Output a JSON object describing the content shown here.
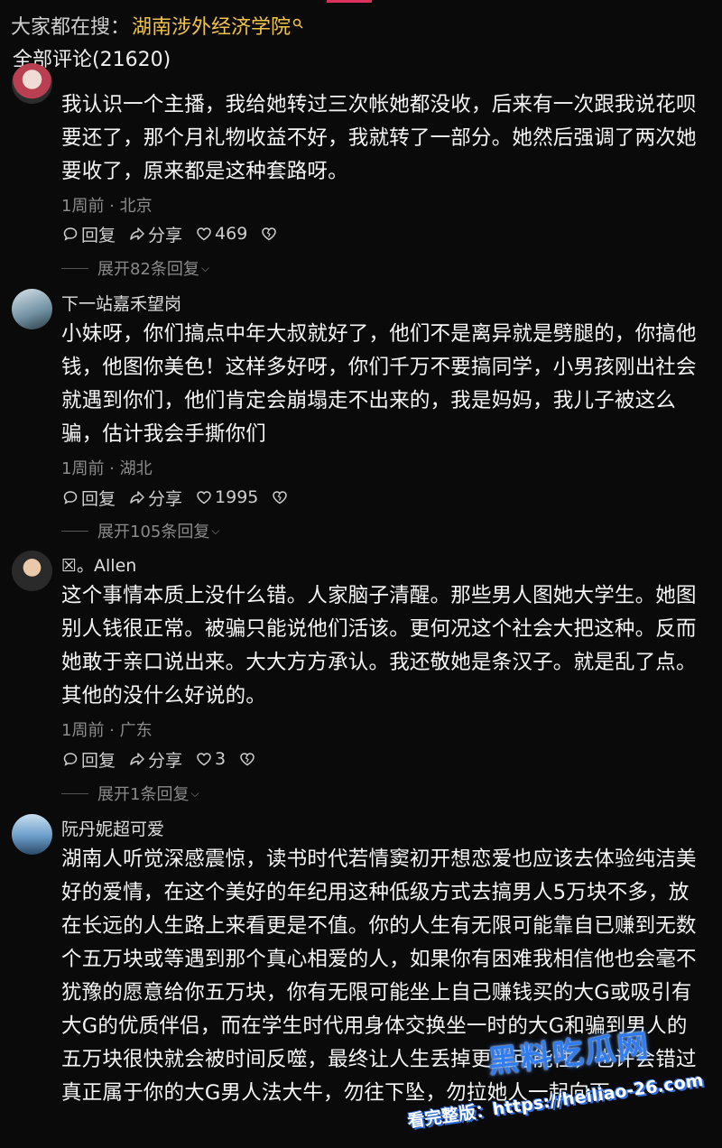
{
  "header": {
    "hot_search_label": "大家都在搜：",
    "hot_search_keyword": "湖南涉外经济学院",
    "comment_count_label": "全部评论(21620)"
  },
  "comments": [
    {
      "user": "",
      "text": "我认识一个主播，我给她转过三次帐她都没收，后来有一次跟我说花呗要还了，那个月礼物收益不好，我就转了一部分。她然后强调了两次她要收了，原来都是这种套路呀。",
      "meta": "1周前 · 北京",
      "reply": "回复",
      "share": "分享",
      "likes": "469",
      "expand": "展开82条回复"
    },
    {
      "user": "下一站嘉禾望岗",
      "text": "小妹呀，你们搞点中年大叔就好了，他们不是离异就是劈腿的，你搞他钱，他图你美色！这样多好呀，你们千万不要搞同学，小男孩刚出社会就遇到你们，他们肯定会崩塌走不出来的，我是妈妈，我儿子被这么骗，估计我会手撕你们",
      "meta": "1周前 · 湖北",
      "reply": "回复",
      "share": "分享",
      "likes": "1995",
      "expand": "展开105条回复"
    },
    {
      "user": "☒。Allen",
      "text": "这个事情本质上没什么错。人家脑子清醒。那些男人图她大学生。她图别人钱很正常。被骗只能说他们活该。更何况这个社会大把这种。反而她敢于亲口说出来。大大方方承认。我还敬她是条汉子。就是乱了点。其他的没什么好说的。",
      "meta": "1周前 · 广东",
      "reply": "回复",
      "share": "分享",
      "likes": "3",
      "expand": "展开1条回复"
    },
    {
      "user": "阮丹妮超可爱",
      "text": "湖南人听觉深感震惊，读书时代若情窦初开想恋爱也应该去体验纯洁美好的爱情，在这个美好的年纪用这种低级方式去搞男人5万块不多，放在长远的人生路上来看更是不值。你的人生有无限可能靠自已赚到无数个五万块或等遇到那个真心相爱的人，如果你有困难我相信他也会毫不犹豫的愿意给你五万块，你有无限可能坐上自己赚钱买的大G或吸引有大G的优质伴侣，而在学生时代用身体交换坐一时的大G和骗到男人的五万块很快就会被时间反噬，最终让人生丢掉更大可能性，也许会错过真正属于你的大G男人法大牛，勿往下坠，勿拉她人一起向下"
    }
  ],
  "watermark": {
    "logo": "黑料吃瓜网",
    "url": "看完整版：https://heiliao-26.com"
  },
  "icons": {
    "reply": "comment-bubble-icon",
    "share": "share-arrow-icon",
    "like": "heart-icon",
    "dislike": "broken-heart-icon",
    "search": "search-icon"
  },
  "colors": {
    "keyword": "#f3c44a",
    "background": "#0a0a0a",
    "accent": "#d9315c"
  }
}
